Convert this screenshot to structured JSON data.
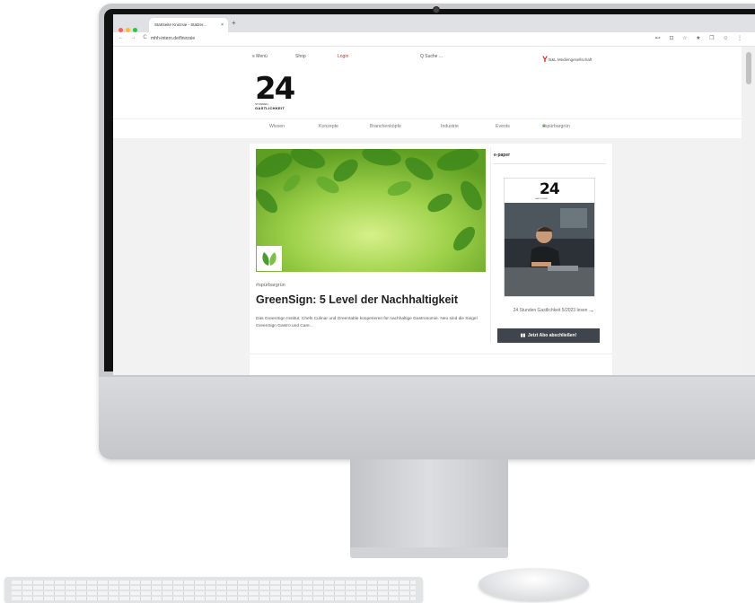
{
  "browser": {
    "tab_title": "Startseite Knirzsie - Statzer...",
    "tab_close": "×",
    "new_tab": "+",
    "url_text": "mhh-intern.de/finirzsie",
    "nav_arrows": "← → C",
    "right_icons": "⊷ ⊡ ☆ ★ ❐ ☺ ⋮"
  },
  "site_nav": {
    "menu": "≡ Menü",
    "shop": "Shop",
    "login": "Login",
    "search": "Q Suche ...",
    "publisher": "B&L Mediengesellschaft"
  },
  "logo": {
    "number": "24",
    "line1": "STUNDEN",
    "line2": "GASTLICHKEIT"
  },
  "categories": [
    "Wissen",
    "Konzepte",
    "Branchenköpfe",
    "Industrie",
    "Events",
    "#spürbargrün"
  ],
  "article": {
    "kicker": "#spürbargrün",
    "headline": "GreenSign: 5 Level der Nachhaltigkeit",
    "teaser": "Das GreenSign Institut, Chefs Culinar und Greentable kooperieren für nachhaltige Gastronomie. Neu sind die Siegel GreenSign Gastro und Care..."
  },
  "sidebar": {
    "heading": "e-paper",
    "cover_number": "24",
    "cover_sub": "GASTLICHKEIT",
    "caption": "24 Stunden Gastlichkeit 5/2023 lesen",
    "caption_arrow": "→",
    "cta": "Jetzt Abo abschließen!"
  },
  "colors": {
    "accent_red": "#e2231a",
    "button_dark": "#3f444d",
    "leaf_green": "#4a9d2c"
  }
}
